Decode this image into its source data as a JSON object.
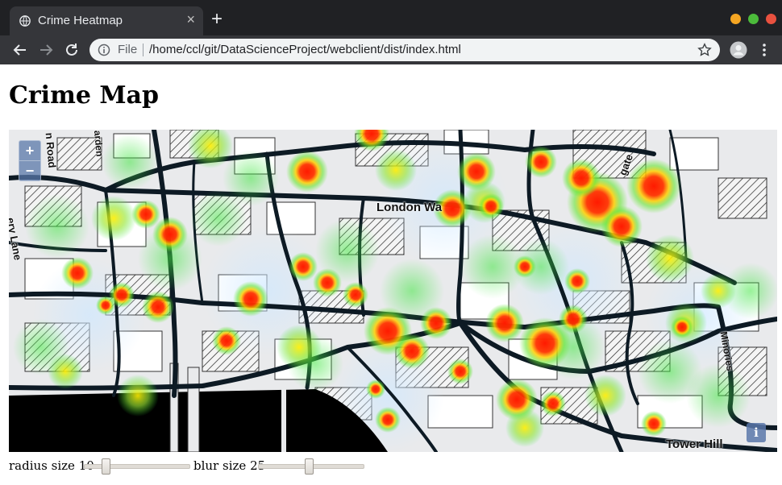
{
  "browser": {
    "tab_title": "Crime Heatmap",
    "tab_close": "×",
    "new_tab": "+",
    "url_scheme_label": "File",
    "url": "/home/ccl/git/DataScienceProject/webclient/dist/index.html"
  },
  "page": {
    "title": "Crime Map"
  },
  "map": {
    "zoom_in_label": "+",
    "zoom_out_label": "−",
    "attribution_label": "i",
    "labels": {
      "london_wall": "London Wa",
      "tower_hill": "Tower Hill",
      "minories": "Minories",
      "aldersgate": "gate",
      "road": "n Road",
      "garden": "arden",
      "lane": "ery Lane"
    },
    "colors": {
      "hot": "#ff1a00",
      "warm": "#ffee00",
      "mild": "#39e639",
      "road": "#0d1a24",
      "water": "#000000"
    }
  },
  "controls": {
    "radius": {
      "label": "radius size",
      "value": "10"
    },
    "blur": {
      "label": "blur size",
      "value": "25"
    }
  }
}
